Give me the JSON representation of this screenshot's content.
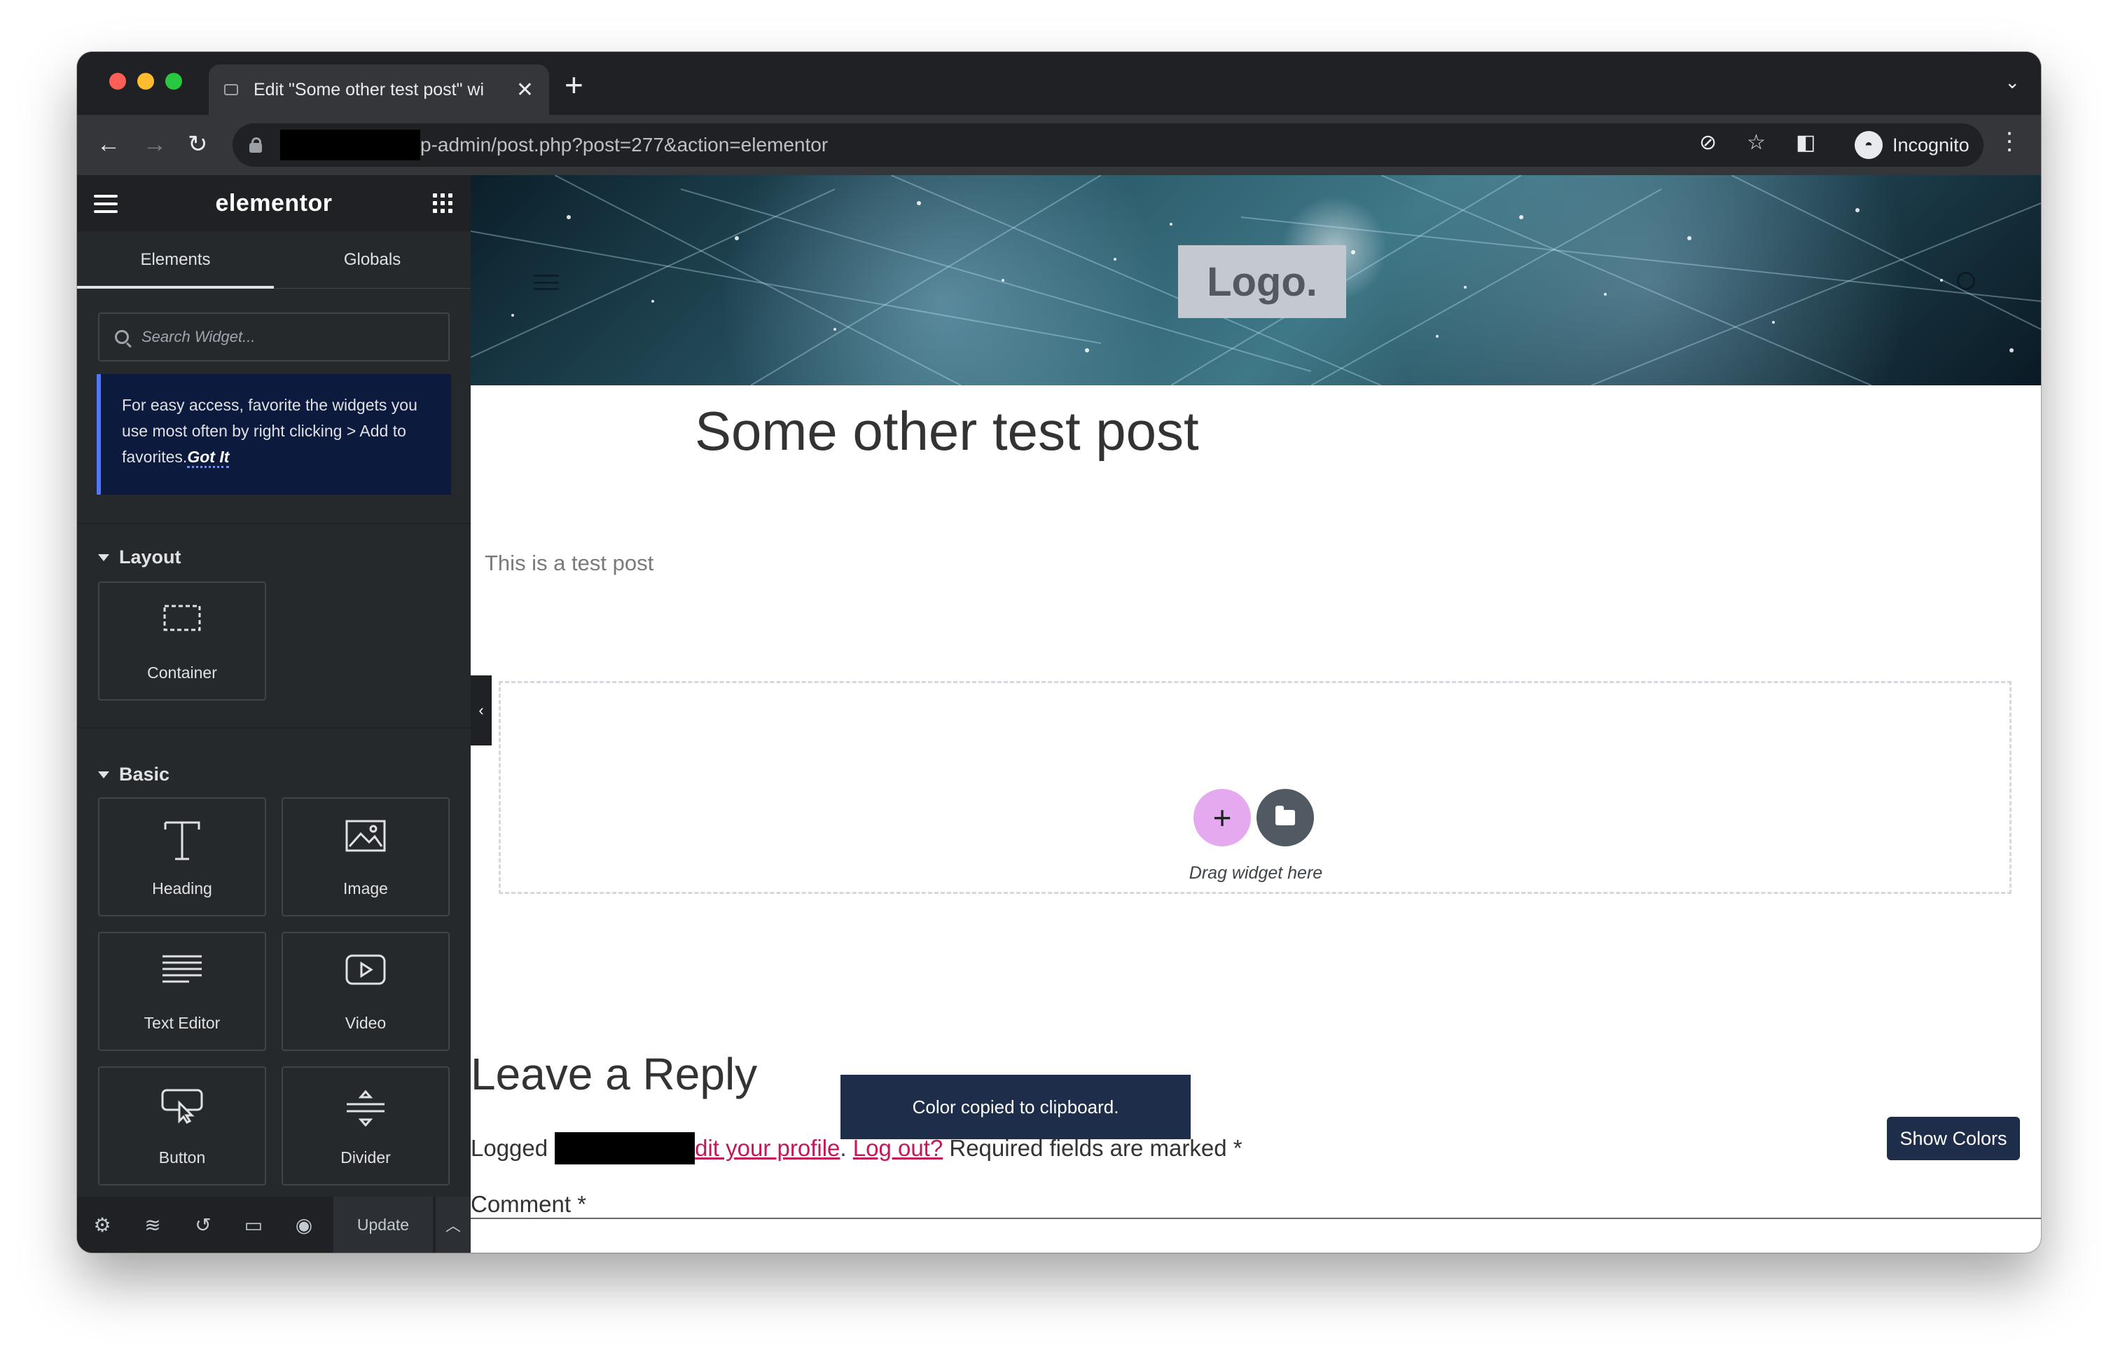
{
  "browser": {
    "tab_title": "Edit \"Some other test post\" wi",
    "url_visible": "p-admin/post.php?post=277&action=elementor",
    "profile_label": "Incognito"
  },
  "panel": {
    "brand": "elementor",
    "tabs": [
      "Elements",
      "Globals"
    ],
    "search_placeholder": "Search Widget...",
    "notice_text": "For easy access, favorite the widgets you use most often by right clicking > Add to favorites.",
    "notice_link": "Got It",
    "categories": {
      "layout": "Layout",
      "basic": "Basic"
    },
    "widgets": {
      "container": "Container",
      "heading": "Heading",
      "image": "Image",
      "text_editor": "Text Editor",
      "video": "Video",
      "button": "Button",
      "divider": "Divider"
    },
    "footer": {
      "update_label": "Update"
    }
  },
  "preview": {
    "logo_text": "Logo.",
    "post_title": "Some other test post",
    "post_body": "This is a test post",
    "drag_label": "Drag widget here",
    "reply_title": "Leave a Reply",
    "logged_prefix": "Logged",
    "edit_profile_link": "dit your profile",
    "separator": ".",
    "logout_link": "Log out?",
    "required_text": "Required fields are marked *",
    "comment_label": "Comment *"
  },
  "toast": {
    "message": "Color copied to clipboard."
  },
  "show_colors_label": "Show Colors",
  "colors": {
    "panel_bg": "#26292c",
    "notice_bg": "#0c1a3d",
    "accent_blue": "#5177ff",
    "add_button": "#e5a9f0",
    "link_pink": "#c1185b",
    "toast_bg": "#1e2d4a"
  }
}
